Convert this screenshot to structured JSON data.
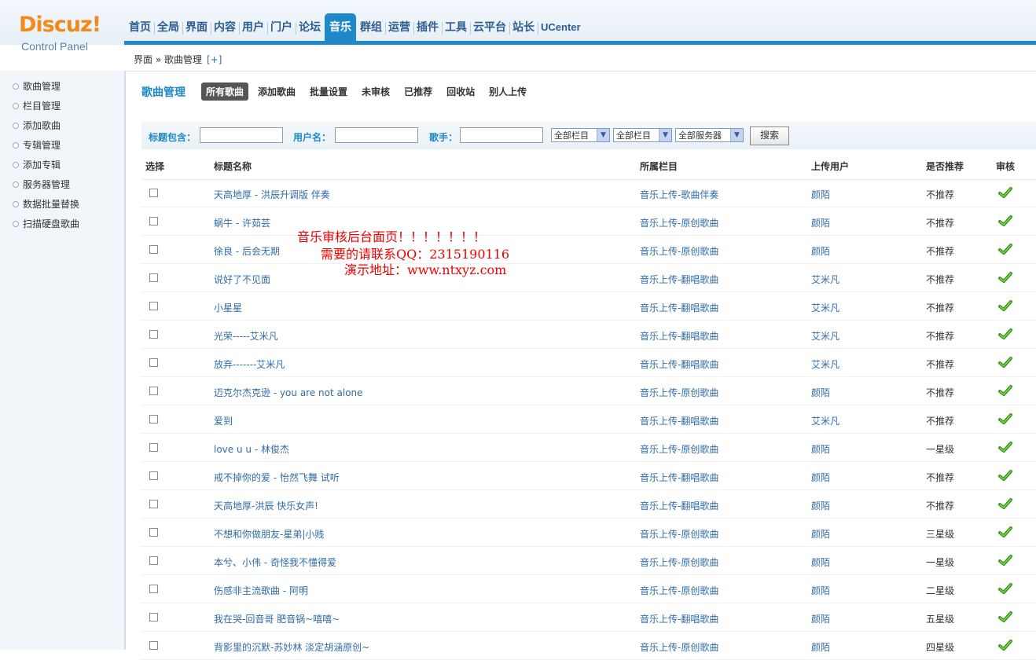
{
  "logo": {
    "main": "Discuz",
    "bang": "!",
    "sub": "Control Panel"
  },
  "nav": [
    "首页",
    "全局",
    "界面",
    "内容",
    "用户",
    "门户",
    "论坛",
    "音乐",
    "群组",
    "运营",
    "插件",
    "工具",
    "云平台",
    "站长",
    "UCenter"
  ],
  "nav_active": "音乐",
  "breadcrumb": {
    "path": "界面 » 歌曲管理",
    "expand": "[+]"
  },
  "sidebar": [
    "歌曲管理",
    "栏目管理",
    "添加歌曲",
    "专辑管理",
    "添加专辑",
    "服务器管理",
    "数据批量替换",
    "扫描硬盘歌曲"
  ],
  "section_title": "歌曲管理",
  "tabs": [
    "所有歌曲",
    "添加歌曲",
    "批量设置",
    "未审核",
    "已推荐",
    "回收站",
    "别人上传"
  ],
  "filter": {
    "title_label": "标题包含：",
    "user_label": "用户名：",
    "singer_label": "歌手：",
    "title_value": "",
    "user_value": "",
    "singer_value": "",
    "select1": "全部栏目",
    "select2": "全部栏目",
    "select3": "全部服务器",
    "search_btn": "搜索"
  },
  "columns": [
    "选择",
    "标题名称",
    "所属栏目",
    "上传用户",
    "是否推荐",
    "审核"
  ],
  "rows": [
    {
      "name": "天高地厚 - 洪辰升调版 伴奏",
      "cat": "音乐上传-歌曲伴奏",
      "user": "颜陌",
      "rec": "不推荐"
    },
    {
      "name": "蜗牛 - 许茹芸",
      "cat": "音乐上传-原创歌曲",
      "user": "颜陌",
      "rec": "不推荐"
    },
    {
      "name": "徐良 - 后会无期",
      "cat": "音乐上传-原创歌曲",
      "user": "颜陌",
      "rec": "不推荐"
    },
    {
      "name": "说好了不见面",
      "cat": "音乐上传-翻唱歌曲",
      "user": "艾米凡",
      "rec": "不推荐"
    },
    {
      "name": "小星星",
      "cat": "音乐上传-翻唱歌曲",
      "user": "艾米凡",
      "rec": "不推荐"
    },
    {
      "name": "光荣-----艾米凡",
      "cat": "音乐上传-翻唱歌曲",
      "user": "艾米凡",
      "rec": "不推荐"
    },
    {
      "name": "放弃-------艾米凡",
      "cat": "音乐上传-翻唱歌曲",
      "user": "艾米凡",
      "rec": "不推荐"
    },
    {
      "name": "迈克尔杰克逊 - you are not alone",
      "cat": "音乐上传-原创歌曲",
      "user": "颜陌",
      "rec": "不推荐"
    },
    {
      "name": "爱到",
      "cat": "音乐上传-翻唱歌曲",
      "user": "艾米凡",
      "rec": "不推荐"
    },
    {
      "name": "love u u - 林俊杰",
      "cat": "音乐上传-原创歌曲",
      "user": "颜陌",
      "rec": "一星级"
    },
    {
      "name": "戒不掉你的爱 - 怡然飞舞 试听",
      "cat": "音乐上传-翻唱歌曲",
      "user": "颜陌",
      "rec": "不推荐"
    },
    {
      "name": "天高地厚-洪辰 快乐女声!",
      "cat": "音乐上传-翻唱歌曲",
      "user": "颜陌",
      "rec": "不推荐"
    },
    {
      "name": "不想和你做朋友-星弟|小贱",
      "cat": "音乐上传-原创歌曲",
      "user": "颜陌",
      "rec": "三星级"
    },
    {
      "name": "本兮、小伟 - 奇怪我不懂得爱",
      "cat": "音乐上传-原创歌曲",
      "user": "颜陌",
      "rec": "一星级"
    },
    {
      "name": "伤感非主流歌曲 - 阿明",
      "cat": "音乐上传-原创歌曲",
      "user": "颜陌",
      "rec": "二星级"
    },
    {
      "name": "我在哭-回音哥 肥音锅~嘻嘻~",
      "cat": "音乐上传-翻唱歌曲",
      "user": "颜陌",
      "rec": "五星级"
    },
    {
      "name": "背影里的沉默-苏妙林 淡定胡涵原创~",
      "cat": "音乐上传-原创歌曲",
      "user": "颜陌",
      "rec": "四星级"
    }
  ],
  "watermark": [
    "音乐审核后台面页！！！！！！！",
    "需要的请联系QQ：2315190116",
    "演示地址：www.ntxyz.com"
  ],
  "colors": {
    "accent": "#1e88c8",
    "link": "#2f6ca8",
    "logo": "#f08b1a",
    "watermark": "#ee0000",
    "check": "#3aa51a"
  },
  "icons": {
    "approve": "check-icon",
    "sidebar_bullet": "circle-icon",
    "select_arrow": "chevron-down-icon"
  }
}
